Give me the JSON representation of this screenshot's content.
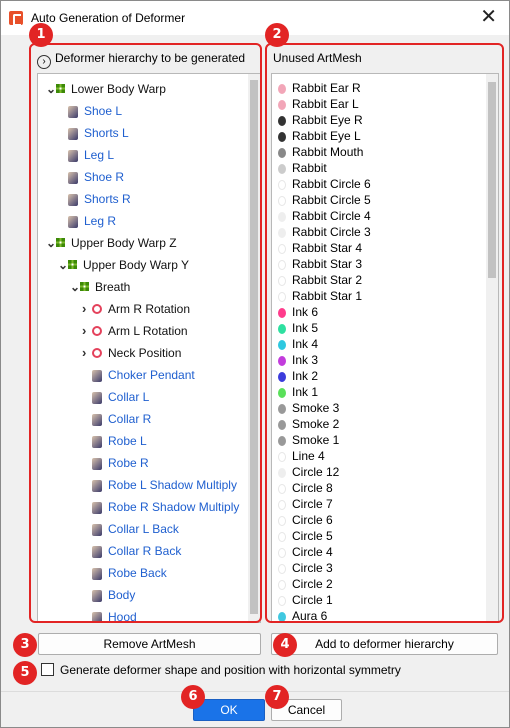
{
  "window": {
    "title": "Auto Generation of Deformer",
    "close_glyph": "✕"
  },
  "left_panel": {
    "header": "Deformer hierarchy to be generated",
    "header_icon_glyph": "›",
    "items": [
      {
        "label": "Lower Body Warp",
        "type": "warp",
        "level": 0,
        "expanded": true
      },
      {
        "label": "Shoe L",
        "type": "mesh",
        "level": 1
      },
      {
        "label": "Shorts L",
        "type": "mesh",
        "level": 1
      },
      {
        "label": "Leg L",
        "type": "mesh",
        "level": 1
      },
      {
        "label": "Shoe R",
        "type": "mesh",
        "level": 1
      },
      {
        "label": "Shorts R",
        "type": "mesh",
        "level": 1
      },
      {
        "label": "Leg R",
        "type": "mesh",
        "level": 1
      },
      {
        "label": "Upper Body Warp Z",
        "type": "warp",
        "level": 0,
        "expanded": true
      },
      {
        "label": "Upper Body Warp Y",
        "type": "warp",
        "level": 1,
        "expanded": true
      },
      {
        "label": "Breath",
        "type": "warp",
        "level": 2,
        "expanded": true
      },
      {
        "label": "Arm R Rotation",
        "type": "rotation",
        "level": 3,
        "expanded": false
      },
      {
        "label": "Arm L Rotation",
        "type": "rotation",
        "level": 3,
        "expanded": false
      },
      {
        "label": "Neck Position",
        "type": "rotation",
        "level": 3,
        "expanded": false
      },
      {
        "label": "Choker Pendant",
        "type": "mesh",
        "level": 3
      },
      {
        "label": "Collar L",
        "type": "mesh",
        "level": 3
      },
      {
        "label": "Collar R",
        "type": "mesh",
        "level": 3
      },
      {
        "label": "Robe L",
        "type": "mesh",
        "level": 3
      },
      {
        "label": "Robe R",
        "type": "mesh",
        "level": 3
      },
      {
        "label": "Robe L Shadow Multiply",
        "type": "mesh",
        "level": 3
      },
      {
        "label": "Robe R Shadow Multiply",
        "type": "mesh",
        "level": 3
      },
      {
        "label": "Collar L Back",
        "type": "mesh",
        "level": 3
      },
      {
        "label": "Collar R Back",
        "type": "mesh",
        "level": 3
      },
      {
        "label": "Robe Back",
        "type": "mesh",
        "level": 3
      },
      {
        "label": "Body",
        "type": "mesh",
        "level": 3
      },
      {
        "label": "Hood",
        "type": "mesh",
        "level": 3
      }
    ]
  },
  "right_panel": {
    "header": "Unused ArtMesh",
    "items": [
      {
        "label": "Rabbit Ear R",
        "color": "#f2a6b8"
      },
      {
        "label": "Rabbit Ear L",
        "color": "#f2a6b8"
      },
      {
        "label": "Rabbit Eye R",
        "color": "#333333"
      },
      {
        "label": "Rabbit Eye L",
        "color": "#333333"
      },
      {
        "label": "Rabbit Mouth",
        "color": "#888888"
      },
      {
        "label": "Rabbit",
        "color": "#cccccc"
      },
      {
        "label": "Rabbit Circle 6",
        "color": "#ffffff"
      },
      {
        "label": "Rabbit Circle 5",
        "color": "#ffffff"
      },
      {
        "label": "Rabbit Circle 4",
        "color": "#eeeeee"
      },
      {
        "label": "Rabbit Circle 3",
        "color": "#eeeeee"
      },
      {
        "label": "Rabbit Star 4",
        "color": "#ffffff"
      },
      {
        "label": "Rabbit Star 3",
        "color": "#ffffff"
      },
      {
        "label": "Rabbit Star 2",
        "color": "#ffffff"
      },
      {
        "label": "Rabbit Star 1",
        "color": "#ffffff"
      },
      {
        "label": "Ink 6",
        "color": "#ff3c8c"
      },
      {
        "label": "Ink 5",
        "color": "#2ee0a0"
      },
      {
        "label": "Ink 4",
        "color": "#2ec8e0"
      },
      {
        "label": "Ink 3",
        "color": "#c23cdc"
      },
      {
        "label": "Ink 2",
        "color": "#3c3cdc"
      },
      {
        "label": "Ink 1",
        "color": "#5ae05a"
      },
      {
        "label": "Smoke 3",
        "color": "#999999"
      },
      {
        "label": "Smoke 2",
        "color": "#999999"
      },
      {
        "label": "Smoke 1",
        "color": "#999999"
      },
      {
        "label": "Line 4",
        "color": "#ffffff"
      },
      {
        "label": "Circle 12",
        "color": "#eeeeee"
      },
      {
        "label": "Circle 8",
        "color": "#ffffff"
      },
      {
        "label": "Circle 7",
        "color": "#ffffff"
      },
      {
        "label": "Circle 6",
        "color": "#ffffff"
      },
      {
        "label": "Circle 5",
        "color": "#ffffff"
      },
      {
        "label": "Circle 4",
        "color": "#ffffff"
      },
      {
        "label": "Circle 3",
        "color": "#ffffff"
      },
      {
        "label": "Circle 2",
        "color": "#ffffff"
      },
      {
        "label": "Circle 1",
        "color": "#ffffff"
      },
      {
        "label": "Aura 6",
        "color": "#40c8e0"
      }
    ]
  },
  "buttons": {
    "remove": "Remove ArtMesh",
    "add": "Add to deformer hierarchy",
    "ok": "OK",
    "cancel": "Cancel"
  },
  "symmetry_checkbox": {
    "label": "Generate deformer shape and position with horizontal symmetry",
    "checked": false
  },
  "annotations": [
    "1",
    "2",
    "3",
    "4",
    "5",
    "6",
    "7"
  ],
  "colors": {
    "accent": "#1a73e8",
    "link_blue": "#1f5fcf",
    "highlight_red": "#e22424",
    "warp_green": "#7dbb2c",
    "rotation_red": "#e4415b"
  }
}
